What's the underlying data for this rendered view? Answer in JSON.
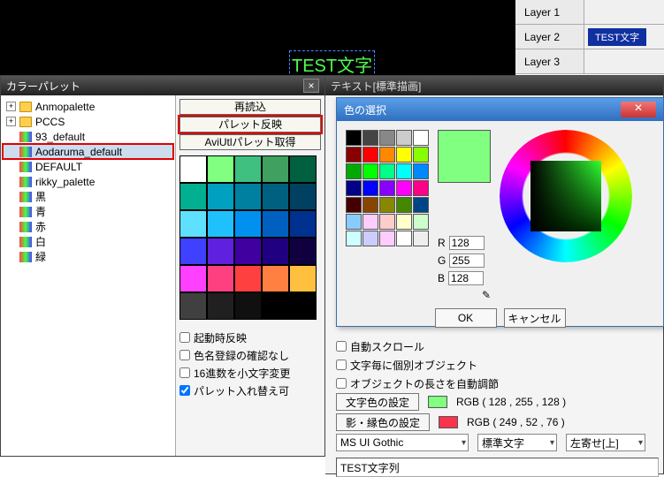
{
  "canvas": {
    "text": "TEST文字"
  },
  "layers": {
    "items": [
      {
        "label": "Layer 1",
        "object": ""
      },
      {
        "label": "Layer 2",
        "object": "TEST文字"
      },
      {
        "label": "Layer 3",
        "object": ""
      }
    ]
  },
  "palette_win": {
    "title": "カラーパレット",
    "tree": [
      {
        "label": "Anmopalette",
        "type": "folder"
      },
      {
        "label": "PCCS",
        "type": "folder"
      },
      {
        "label": "93_default",
        "type": "file"
      },
      {
        "label": "Aodaruma_default",
        "type": "file",
        "highlight": true
      },
      {
        "label": "DEFAULT",
        "type": "file"
      },
      {
        "label": "rikky_palette",
        "type": "file"
      },
      {
        "label": "黒",
        "type": "file"
      },
      {
        "label": "青",
        "type": "file"
      },
      {
        "label": "赤",
        "type": "file"
      },
      {
        "label": "白",
        "type": "file"
      },
      {
        "label": "緑",
        "type": "file"
      }
    ],
    "buttons": {
      "reload": "再読込",
      "reflect": "パレット反映",
      "aviutl": "AviUtlパレット取得"
    },
    "swatches": [
      "#ffffff",
      "#80ff80",
      "#40c080",
      "#40a060",
      "#006040",
      "#00b090",
      "#00a0c0",
      "#0080a0",
      "#006080",
      "#004060",
      "#60e0ff",
      "#20c0ff",
      "#0090f0",
      "#0060c0",
      "#003090",
      "#4040ff",
      "#6020e0",
      "#4000a0",
      "#200080",
      "#100040",
      "#ff40ff",
      "#ff4080",
      "#ff4040",
      "#ff8040",
      "#ffc040",
      "#404040",
      "#202020",
      "#101010",
      "#000000",
      "#000000"
    ],
    "checks": {
      "start_reflect": "起動時反映",
      "color_confirm": "色名登録の確認なし",
      "hex_lower": "16進数を小文字変更",
      "swap_ok": "パレット入れ替え可"
    }
  },
  "text_win": {
    "title": "テキスト[標準描画]"
  },
  "color_dlg": {
    "title": "色の選択",
    "preview_color": "#80ff80",
    "mini_swatches": [
      "#000",
      "#444",
      "#888",
      "#ccc",
      "#fff",
      "#800",
      "#f00",
      "#f80",
      "#ff0",
      "#8f0",
      "#0a0",
      "#0f0",
      "#0f8",
      "#0ff",
      "#08f",
      "#008",
      "#00f",
      "#80f",
      "#f0f",
      "#f08",
      "#400",
      "#840",
      "#880",
      "#480",
      "#048",
      "#8cf",
      "#fcf",
      "#fcc",
      "#ffc",
      "#cfc",
      "#cff",
      "#ccf",
      "#fcf",
      "#fff",
      "#eee"
    ],
    "rgb": {
      "r_label": "R",
      "g_label": "G",
      "b_label": "B",
      "r": "128",
      "g": "255",
      "b": "128"
    },
    "ok": "OK",
    "cancel": "キャンセル"
  },
  "settings": {
    "auto_scroll": "自動スクロール",
    "per_char_obj": "文字毎に個別オブジェクト",
    "auto_len": "オブジェクトの長さを自動調節",
    "char_color_btn": "文字色の設定",
    "char_color_val": "RGB ( 128 , 255 , 128 )",
    "shadow_color_btn": "影・縁色の設定",
    "shadow_color_val": "RGB ( 249 , 52 , 76 )",
    "font": "MS UI Gothic",
    "style": "標準文字",
    "align": "左寄せ[上]",
    "text_value": "TEST文字列",
    "char_color_hex": "#80ff80",
    "shadow_color_hex": "#f9344c"
  }
}
